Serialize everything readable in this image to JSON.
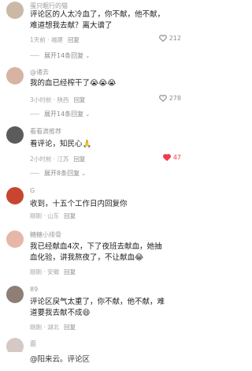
{
  "comments": [
    {
      "user": "蛋只眠行的猫",
      "text": "评论区的人太冷血了，你不献，他不献，难道想我去献？离大谱了",
      "time": "1天前",
      "location": "福建",
      "reply_label": "回复",
      "likes": "212",
      "liked": false,
      "expand_label": "展开14条回复",
      "avatar_color": "#c9b9a6"
    },
    {
      "user": "@诸去",
      "text": "我的血已经榨干了😭😭😭",
      "time": "3小时前",
      "location": "陕西",
      "reply_label": "回复",
      "likes": "278",
      "liked": false,
      "expand_label": "展开14条回复",
      "avatar_color": "#d8b3a3"
    },
    {
      "user": "看看滴推荐",
      "text": "看评论，知民心🙏",
      "time": "2小时前",
      "location": "江苏",
      "reply_label": "回复",
      "likes": "47",
      "liked": true,
      "expand_label": "展开8条回复",
      "avatar_color": "#5b5b5b"
    },
    {
      "user": "G",
      "text": "收到，十五个工作日内回复你",
      "time": "刚刚",
      "location": "山东",
      "reply_label": "回复",
      "likes": "",
      "liked": false,
      "expand_label": "",
      "avatar_color": "#c8462f"
    },
    {
      "user": "糖糖小排骨",
      "text": "我已经献血4次，下了夜班去献血，她抽血化验，讲我熬夜了，不让献血😂",
      "time": "刚刚",
      "location": "安徽",
      "reply_label": "回复",
      "likes": "",
      "liked": false,
      "expand_label": "",
      "avatar_color": "#e6b7a8"
    },
    {
      "user": "89",
      "text": "评论区戾气太重了，你不献，他不献，难道要我去献不成😄",
      "time": "刚刚",
      "location": "湖北",
      "reply_label": "回复",
      "likes": "",
      "liked": false,
      "expand_label": "",
      "avatar_color": "#8f7e76"
    }
  ],
  "partial_comment": {
    "user": "面",
    "avatar_color": "#d6c8c4"
  },
  "bottom_text": "@阳来云。评论区"
}
